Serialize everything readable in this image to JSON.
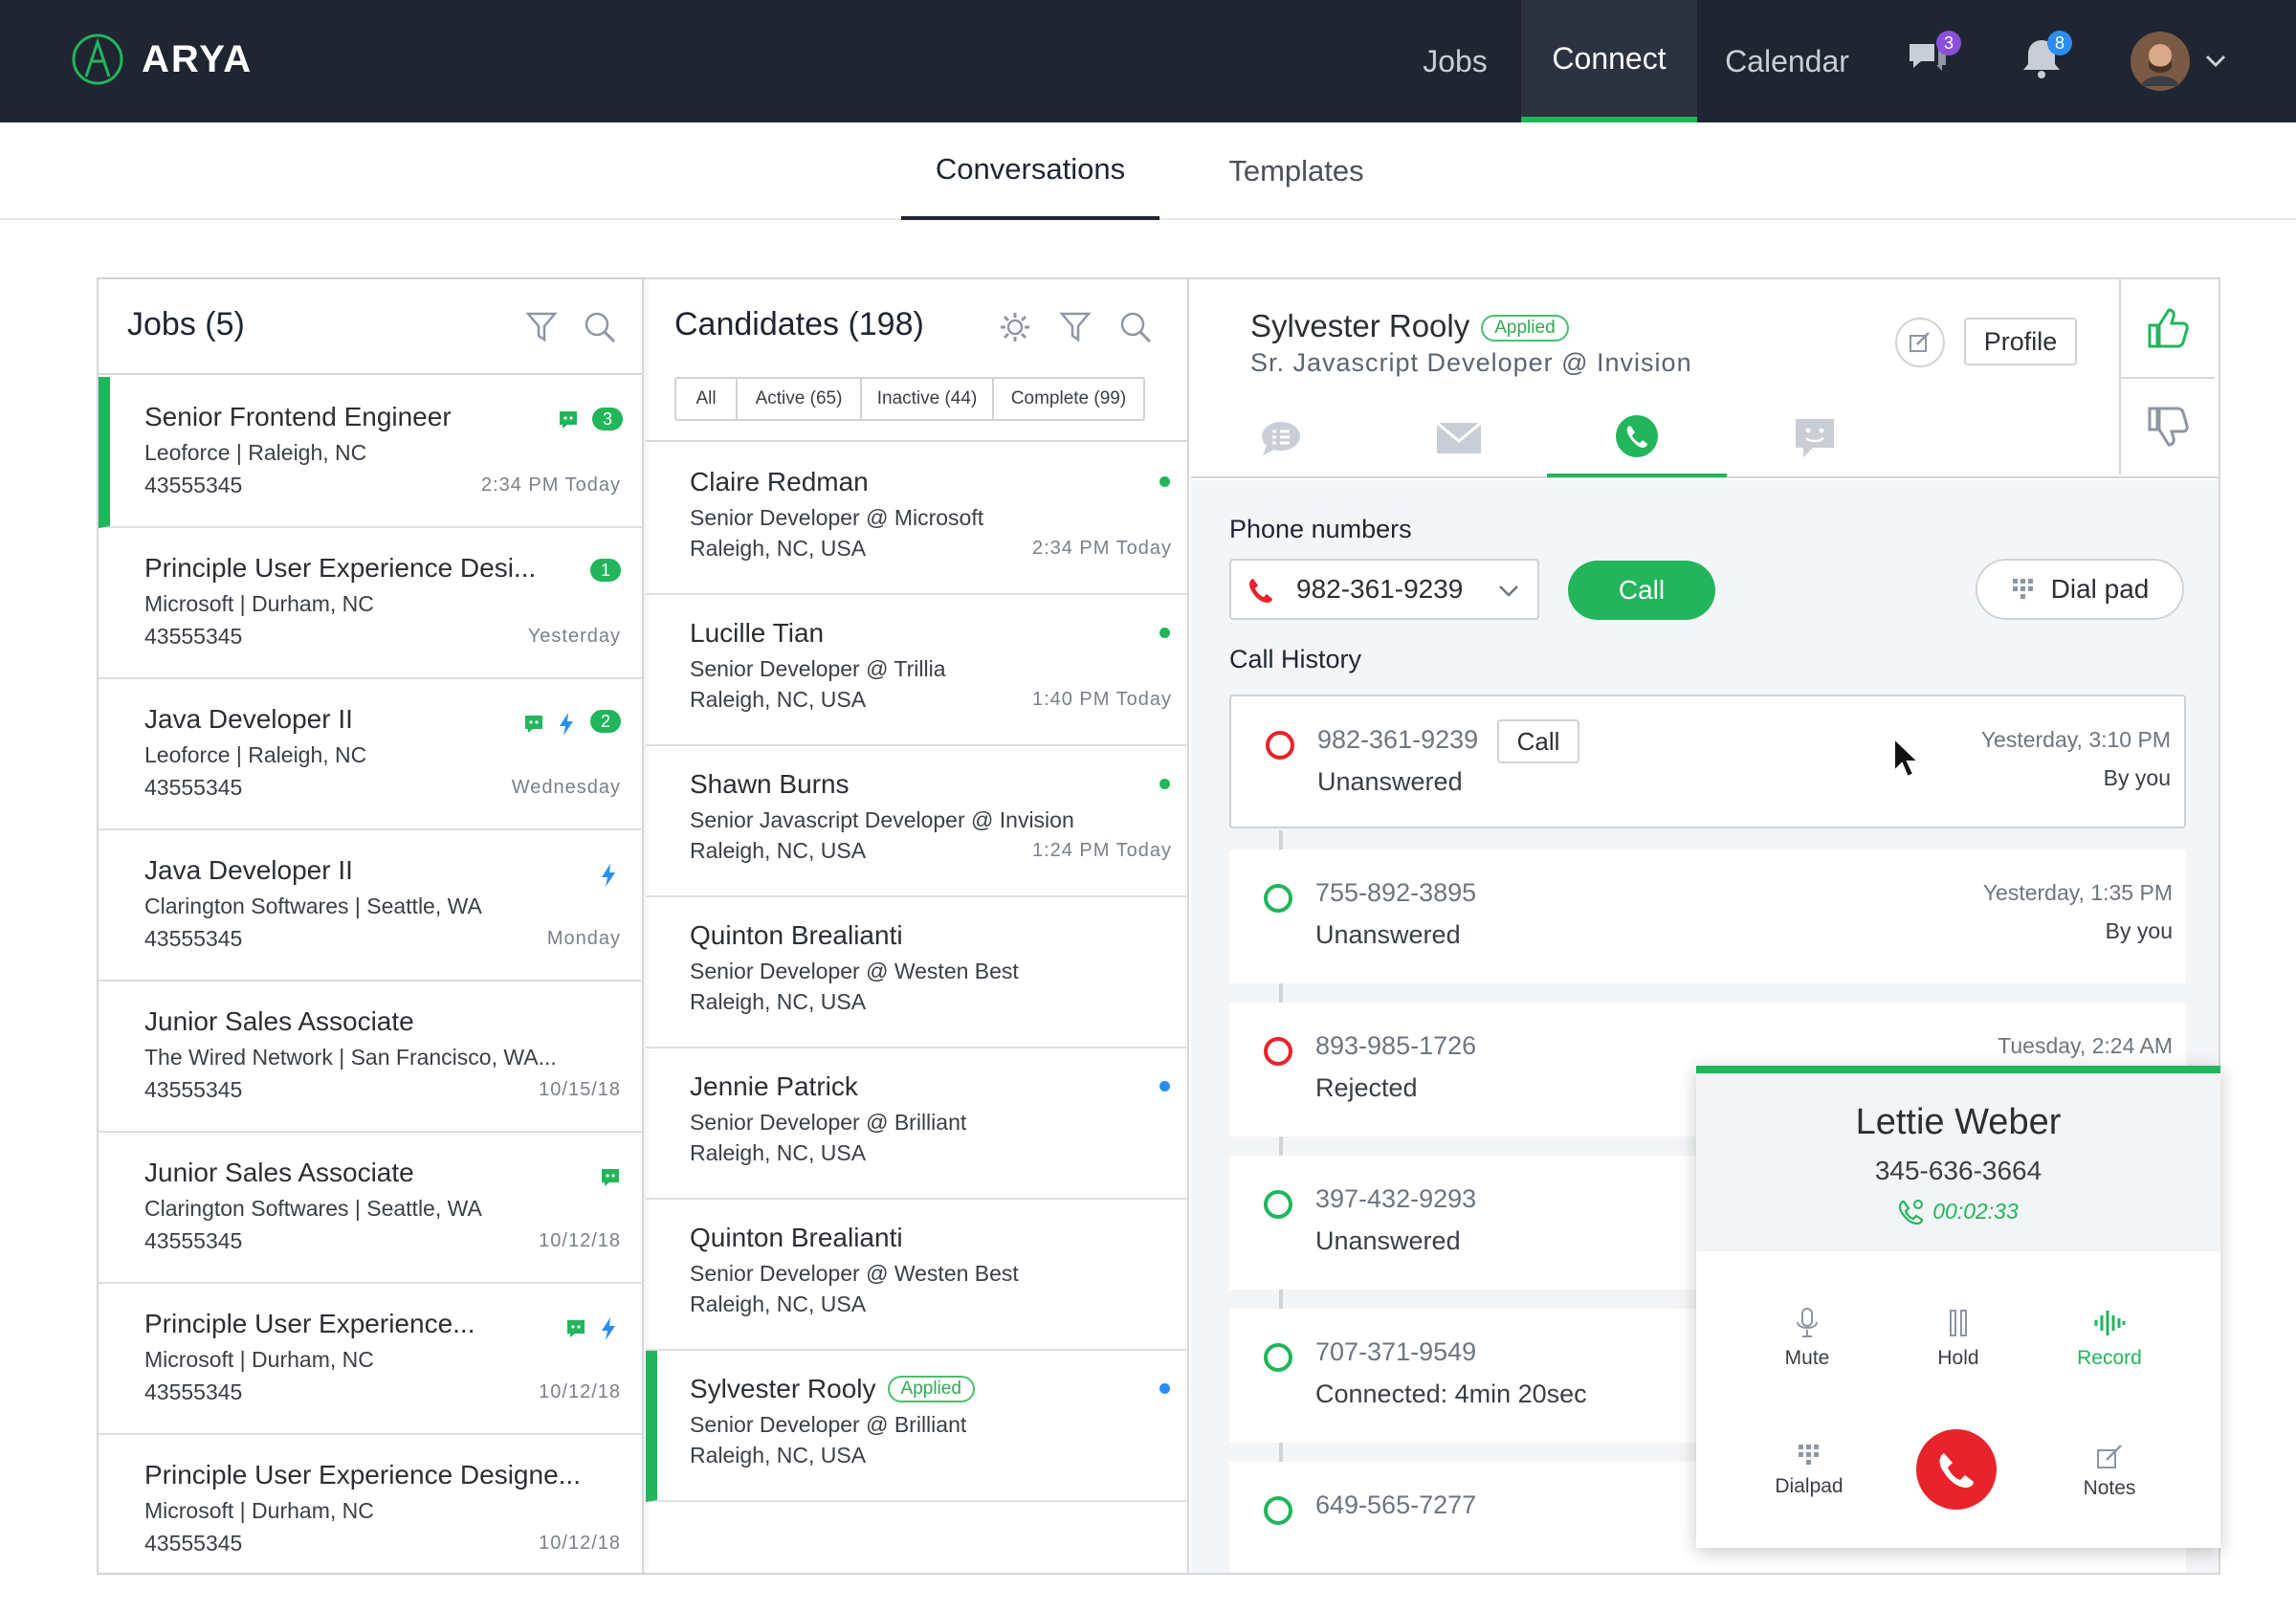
{
  "app": {
    "brand": "ARYA",
    "nav": [
      "Jobs",
      "Connect",
      "Calendar"
    ],
    "messages_badge": "3",
    "notifications_badge": "8",
    "colors": {
      "accent": "#22b55c",
      "topbar": "#1f2531",
      "missed": "#e8232c",
      "info": "#2a8df0"
    }
  },
  "subtabs": [
    "Conversations",
    "Templates"
  ],
  "jobs": {
    "title": "Jobs (5)",
    "items": [
      {
        "title": "Senior Frontend Engineer",
        "sub": "Leoforce | Raleigh, NC",
        "id": "43555345",
        "time": "2:34 PM Today",
        "count": "3"
      },
      {
        "title": "Principle User Experience Desi...",
        "sub": "Microsoft | Durham, NC",
        "id": "43555345",
        "time": "Yesterday",
        "count": "1"
      },
      {
        "title": "Java Developer II",
        "sub": "Leoforce | Raleigh, NC",
        "id": "43555345",
        "time": "Wednesday",
        "count": "2"
      },
      {
        "title": "Java Developer II",
        "sub": "Clarington Softwares | Seattle, WA",
        "id": "43555345",
        "time": "Monday"
      },
      {
        "title": "Junior Sales Associate",
        "sub": "The Wired Network | San Francisco, WA...",
        "id": "43555345",
        "time": "10/15/18"
      },
      {
        "title": "Junior Sales Associate",
        "sub": "Clarington Softwares | Seattle, WA",
        "id": "43555345",
        "time": "10/12/18"
      },
      {
        "title": "Principle User Experience...",
        "sub": "Microsoft | Durham, NC",
        "id": "43555345",
        "time": "10/12/18"
      },
      {
        "title": "Principle User Experience Designe...",
        "sub": "Microsoft | Durham, NC",
        "id": "43555345",
        "time": "10/12/18"
      }
    ]
  },
  "candidates": {
    "title": "Candidates (198)",
    "filters": [
      "All",
      "Active (65)",
      "Inactive (44)",
      "Complete (99)"
    ],
    "applied_label": "Applied",
    "items": [
      {
        "name": "Claire Redman",
        "role": "Senior Developer @ Microsoft",
        "loc": "Raleigh, NC, USA",
        "time": "2:34 PM Today"
      },
      {
        "name": "Lucille Tian",
        "role": "Senior Developer @ Trillia",
        "loc": "Raleigh, NC, USA",
        "time": "1:40 PM Today"
      },
      {
        "name": "Shawn Burns",
        "role": "Senior Javascript Developer @ Invision",
        "loc": "Raleigh, NC, USA",
        "time": "1:24 PM Today"
      },
      {
        "name": "Quinton Brealianti",
        "role": "Senior Developer @ Westen Best",
        "loc": "Raleigh, NC, USA",
        "time": ""
      },
      {
        "name": "Jennie Patrick",
        "role": "Senior Developer @ Brilliant",
        "loc": "Raleigh, NC, USA",
        "time": ""
      },
      {
        "name": "Quinton Brealianti",
        "role": "Senior Developer @ Westen Best",
        "loc": "Raleigh, NC, USA",
        "time": ""
      },
      {
        "name": "Sylvester Rooly",
        "role": "Senior Developer @ Brilliant",
        "loc": "Raleigh, NC, USA",
        "time": ""
      }
    ]
  },
  "detail": {
    "name": "Sylvester Rooly",
    "status": "Applied",
    "role": "Sr. Javascript Developer @ Invision",
    "profile_label": "Profile",
    "phone_numbers_label": "Phone numbers",
    "selected_phone": "982-361-9239",
    "call_label": "Call",
    "dialpad_label": "Dial pad",
    "history_label": "Call History",
    "history": [
      {
        "number": "982-361-9239",
        "status": "Unanswered",
        "when": "Yesterday, 3:10 PM",
        "by": "By you",
        "call_label": "Call"
      },
      {
        "number": "755-892-3895",
        "status": "Unanswered",
        "when": "Yesterday, 1:35 PM",
        "by": "By you"
      },
      {
        "number": "893-985-1726",
        "status": "Rejected",
        "when": "Tuesday, 2:24 AM",
        "by": ""
      },
      {
        "number": "397-432-9293",
        "status": "Unanswered",
        "when": "",
        "by": ""
      },
      {
        "number": "707-371-9549",
        "status": "Connected: 4min 20sec",
        "when": "",
        "by": ""
      },
      {
        "number": "649-565-7277",
        "status": "",
        "when": "",
        "by": ""
      }
    ]
  },
  "active_call": {
    "name": "Lettie Weber",
    "phone": "345-636-3664",
    "timer": "00:02:33",
    "controls": [
      "Mute",
      "Hold",
      "Record",
      "Dialpad",
      "Notes"
    ]
  }
}
